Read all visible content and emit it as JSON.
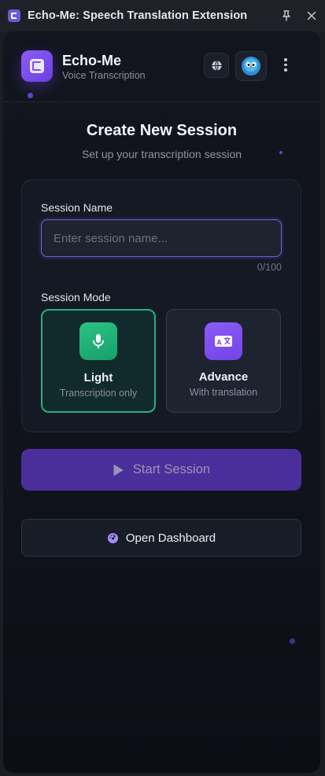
{
  "window": {
    "title": "Echo-Me: Speech Translation Extension",
    "icon": "app-icon",
    "actions": [
      "pin-icon",
      "close-icon"
    ]
  },
  "header": {
    "app_name": "Echo-Me",
    "app_subtitle": "Voice Transcription",
    "buttons": [
      "globe-icon",
      "avatar-icon",
      "more-vertical-icon"
    ]
  },
  "session": {
    "title": "Create New Session",
    "subtitle": "Set up your transcription session",
    "name_label": "Session Name",
    "name_placeholder": "Enter session name...",
    "name_value": "",
    "char_count": "0/100",
    "mode_label": "Session Mode",
    "modes": [
      {
        "title": "Light",
        "description": "Transcription only",
        "icon": "microphone-icon",
        "selected": true,
        "color": "#2bb07a"
      },
      {
        "title": "Advance",
        "description": "With translation",
        "icon": "translate-icon",
        "selected": false,
        "color": "#8b5cf6"
      }
    ]
  },
  "actions": {
    "start_label": "Start Session",
    "start_icon": "play-icon",
    "dashboard_label": "Open Dashboard",
    "dashboard_icon": "dashboard-icon"
  },
  "colors": {
    "accent": "#7c5cf0",
    "accent_dark": "#4a2f9a",
    "success": "#2bb07a",
    "background": "#10131b"
  }
}
